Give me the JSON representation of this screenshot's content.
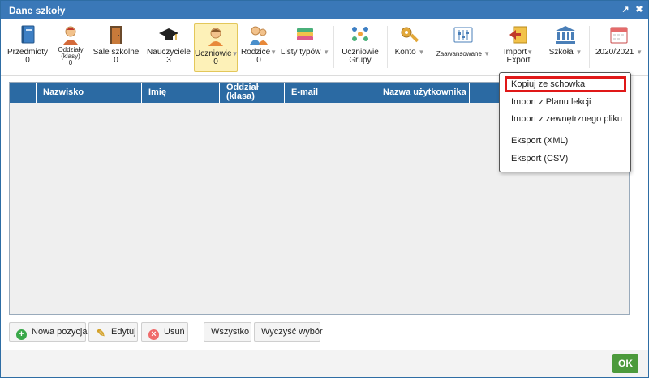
{
  "window": {
    "title": "Dane szkoły",
    "maximize_icon": "↗",
    "close_icon": "✖"
  },
  "toolbar": {
    "przedmioty": {
      "label": "Przedmioty",
      "count": "0"
    },
    "oddzialy": {
      "label": "Oddziały",
      "sub": "(klasy)",
      "count": "0"
    },
    "sale": {
      "label": "Sale szkolne",
      "count": "0"
    },
    "nauczyciele": {
      "label": "Nauczyciele",
      "count": "3"
    },
    "uczniowie": {
      "label": "Uczniowie",
      "count": "0"
    },
    "rodzice": {
      "label": "Rodzice",
      "count": "0"
    },
    "listy": {
      "label": "Listy typów"
    },
    "grupy": {
      "label": "Uczniowie",
      "sub": "Grupy"
    },
    "konto": {
      "label": "Konto"
    },
    "zaawansowane": {
      "label": "Zaawansowane"
    },
    "import": {
      "label": "Import",
      "sub": "Export"
    },
    "szkola": {
      "label": "Szkoła"
    },
    "rok": {
      "label": "2020/2021"
    },
    "arrow": "▼"
  },
  "grid": {
    "columns": [
      "Nazwisko",
      "Imię",
      "Oddział",
      "(klasa)",
      "E-mail",
      "Nazwa użytkownika"
    ]
  },
  "actions": {
    "nowa": "Nowa pozycja",
    "edytuj": "Edytuj",
    "usun": "Usuń",
    "wszystko": "Wszystko",
    "wyczysc": "Wyczyść wybór"
  },
  "footer": {
    "ok": "OK"
  },
  "menu": {
    "items": [
      "Kopiuj ze schowka",
      "Import z Planu lekcji",
      "Import z zewnętrznego pliku",
      "Eksport (XML)",
      "Eksport (CSV)"
    ]
  },
  "colors": {
    "header": "#2b6aa3",
    "titlebar": "#3a78b8",
    "highlight": "#e01818",
    "ok": "#4c9a3c"
  }
}
